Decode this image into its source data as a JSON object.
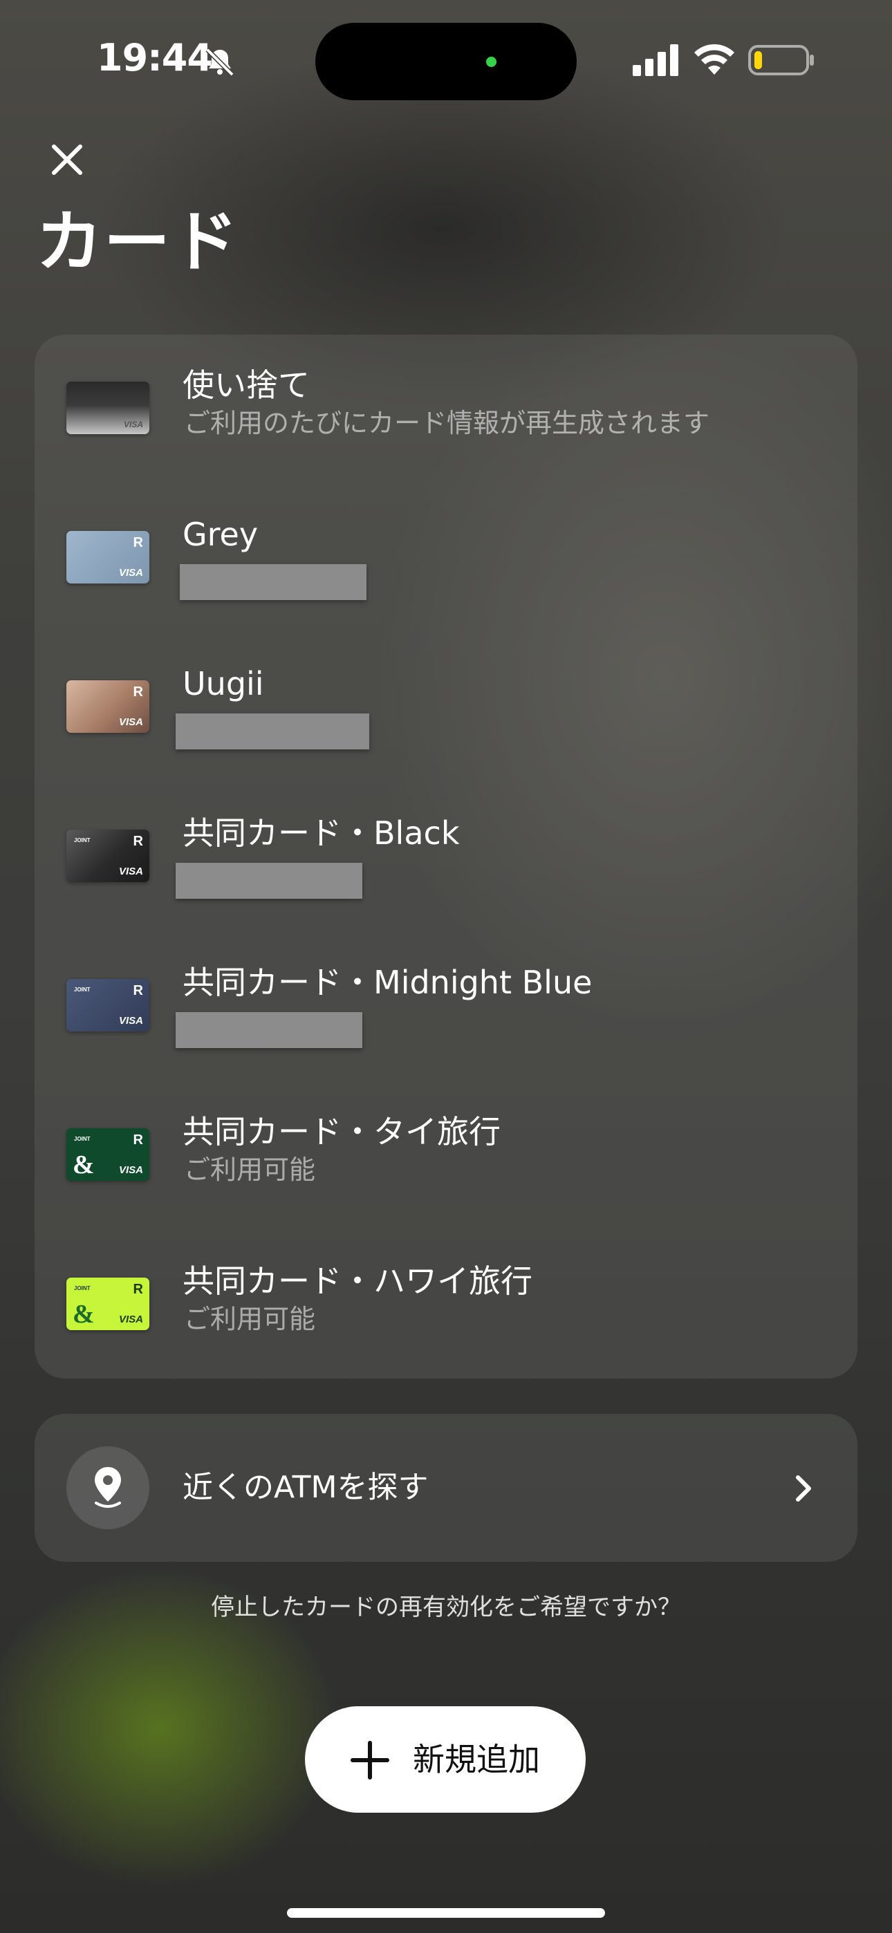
{
  "status_bar": {
    "time": "19:44",
    "icons": [
      "bell-slash-icon",
      "signal-icon",
      "wifi-icon",
      "battery-low-icon"
    ]
  },
  "header": {
    "close_icon": "close-icon",
    "title": "カード"
  },
  "cards": [
    {
      "name": "使い捨て",
      "subtitle": "ご利用のたびにカード情報が再生成されます",
      "thumb_style": "disposable",
      "redacted": false
    },
    {
      "name": "Grey",
      "subtitle": "",
      "thumb_style": "grey",
      "redacted": true
    },
    {
      "name": "Uugii",
      "subtitle": "",
      "thumb_style": "bronze",
      "redacted": true
    },
    {
      "name": "共同カード・Black",
      "subtitle": "",
      "thumb_style": "joint-black",
      "redacted": true
    },
    {
      "name": "共同カード・Midnight Blue",
      "subtitle": "",
      "thumb_style": "joint-midnight-blue",
      "redacted": true
    },
    {
      "name": "共同カード・タイ旅行",
      "subtitle": "ご利用可能",
      "thumb_style": "joint-green",
      "redacted": false
    },
    {
      "name": "共同カード・ハワイ旅行",
      "subtitle": "ご利用可能",
      "thumb_style": "joint-lime",
      "redacted": false
    }
  ],
  "card_thumb_text": {
    "visa": "VISA",
    "r": "R",
    "joint": "JOINT",
    "amp": "&"
  },
  "atm": {
    "label": "近くのATMを探す",
    "icon": "map-pin-icon"
  },
  "reactivate_link": "停止したカードの再有効化をご希望ですか？",
  "add_button": {
    "label": "新規追加",
    "icon": "plus-icon"
  },
  "colors": {
    "panel": "#5c5c58",
    "redacted": "#8c8c8c",
    "joint_green": "#0f4a2c",
    "joint_lime": "#c6f53a",
    "dynamic_island_dot": "#35d24a"
  }
}
